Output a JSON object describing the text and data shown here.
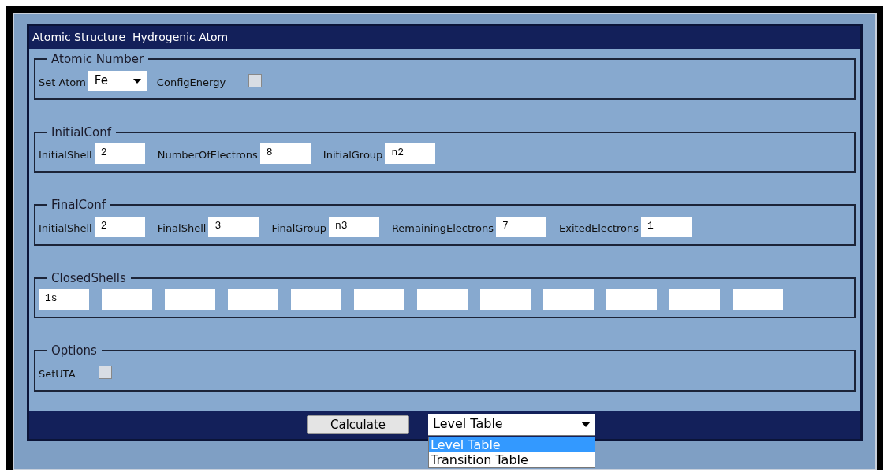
{
  "window": {
    "title": "Atomic Structure  Hydrogenic Atom"
  },
  "sections": [
    {
      "title": "Atomic Number",
      "items": [
        {
          "kind": "select",
          "label": "Set Atom",
          "value": "Fe"
        },
        {
          "kind": "checkbox",
          "label": "ConfigEnergy",
          "checked": false
        }
      ]
    },
    {
      "title": "InitialConf",
      "items": [
        {
          "kind": "field",
          "label": "InitialShell",
          "value": "2"
        },
        {
          "kind": "field",
          "label": "NumberOfElectrons",
          "value": "8"
        },
        {
          "kind": "field",
          "label": "InitialGroup",
          "value": "n2"
        }
      ]
    },
    {
      "title": "FinalConf",
      "items": [
        {
          "kind": "field",
          "label": "InitialShell",
          "value": "2"
        },
        {
          "kind": "field",
          "label": "FinalShell",
          "value": "3"
        },
        {
          "kind": "field",
          "label": "FinalGroup",
          "value": "n3"
        },
        {
          "kind": "field",
          "label": "RemainingElectrons",
          "value": "7"
        },
        {
          "kind": "field",
          "label": "ExitedElectrons",
          "value": "1"
        }
      ]
    },
    {
      "title": "ClosedShells",
      "items": [
        {
          "kind": "field",
          "value": "1s"
        },
        {
          "kind": "field"
        },
        {
          "kind": "field"
        },
        {
          "kind": "field"
        },
        {
          "kind": "field"
        },
        {
          "kind": "field"
        },
        {
          "kind": "field"
        },
        {
          "kind": "field"
        },
        {
          "kind": "field"
        },
        {
          "kind": "field"
        },
        {
          "kind": "field"
        },
        {
          "kind": "field"
        }
      ]
    },
    {
      "title": "Options",
      "items": [
        {
          "kind": "checkbox",
          "label": "SetUTA",
          "checked": false
        }
      ]
    }
  ],
  "footer": {
    "button": "Calculate",
    "table_select": {
      "value": "Level Table",
      "expanded": true,
      "options": [
        {
          "label": "Level Table",
          "selected": true
        },
        {
          "label": "Transition Table",
          "selected": false
        }
      ]
    }
  }
}
